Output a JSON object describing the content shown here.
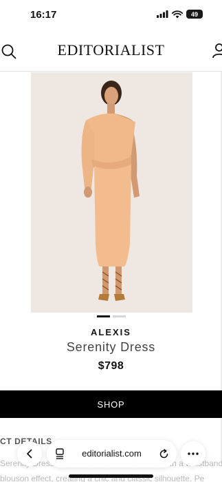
{
  "status_bar": {
    "time": "16:17",
    "battery": "49"
  },
  "header": {
    "logo": "EDITORIALIST",
    "icons": [
      "search-icon",
      "account-icon"
    ]
  },
  "product": {
    "image_icon": "dress-photo",
    "carousel_dots": 2,
    "active_dot": 0,
    "brand": "ALEXIS",
    "name": "Serenity Dress",
    "price": "$798",
    "shop_label": "SHOP"
  },
  "details": {
    "heading": "CT DETAILS",
    "text_line1": "Serenity Dress is a one-shoulder midi dress with a waistband",
    "text_line2": "blouson effect, creating a chic and classic silhouette. Pe"
  },
  "browser": {
    "url": "editorialist.com",
    "icons": [
      "back-icon",
      "tabs-icon",
      "reload-icon",
      "more-icon"
    ]
  },
  "colors": {
    "image_bg": "#efe7e1",
    "dress": "#f0b98a",
    "button_bg": "#000000"
  }
}
